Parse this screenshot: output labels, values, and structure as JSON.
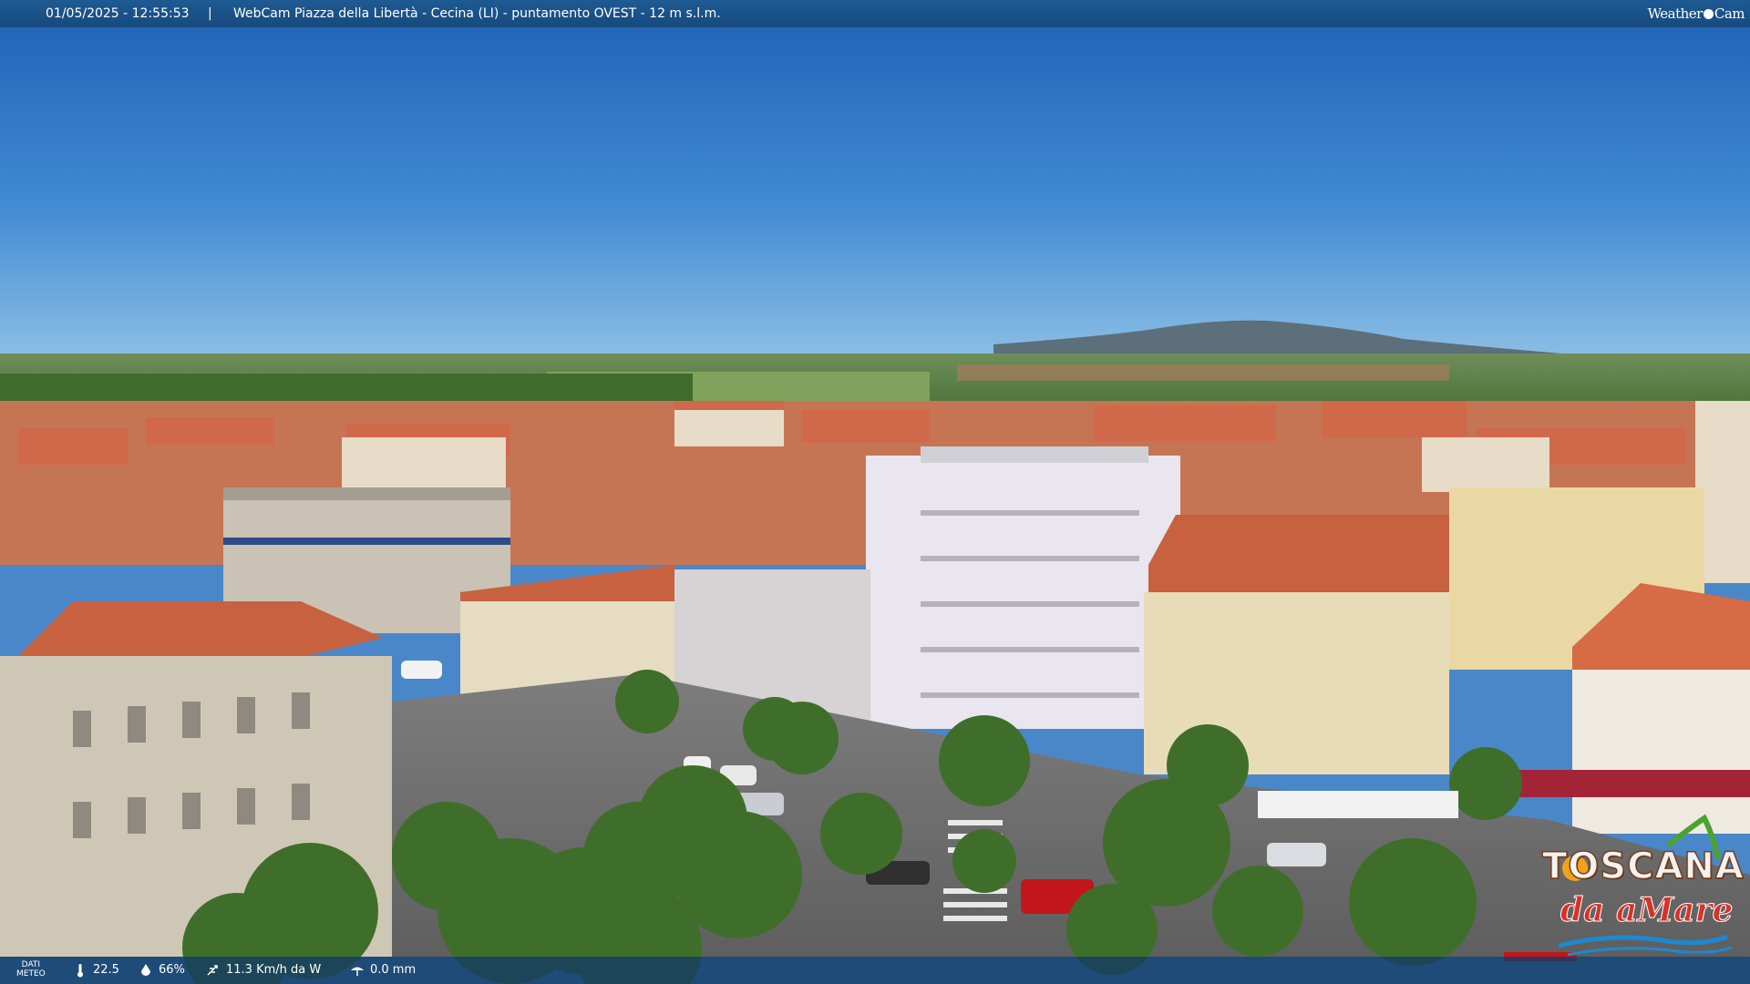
{
  "banner": {
    "timestamp": "01/05/2025 - 12:55:53",
    "separator": "|",
    "title": "WebCam Piazza della Libertà - Cecina (LI) - puntamento OVEST - 12 m s.l.m.",
    "brand_left": "Weather",
    "brand_right": "Cam"
  },
  "weather": {
    "dati_line1": "DATI",
    "dati_line2": "METEO",
    "temperature": "22.5",
    "humidity": "66%",
    "wind": "11.3 Km/h da W",
    "rain": "0.0 mm",
    "icons": [
      "thermometer-icon",
      "humidity-icon",
      "wind-icon",
      "rain-icon"
    ]
  },
  "logo": {
    "word": "TOSCANA",
    "sub": "da aMare"
  },
  "colors": {
    "sky_top": "#1e60b4",
    "sky_horizon": "#8fc0e6",
    "roof": "#c8613f",
    "banner": "#1a5189"
  }
}
